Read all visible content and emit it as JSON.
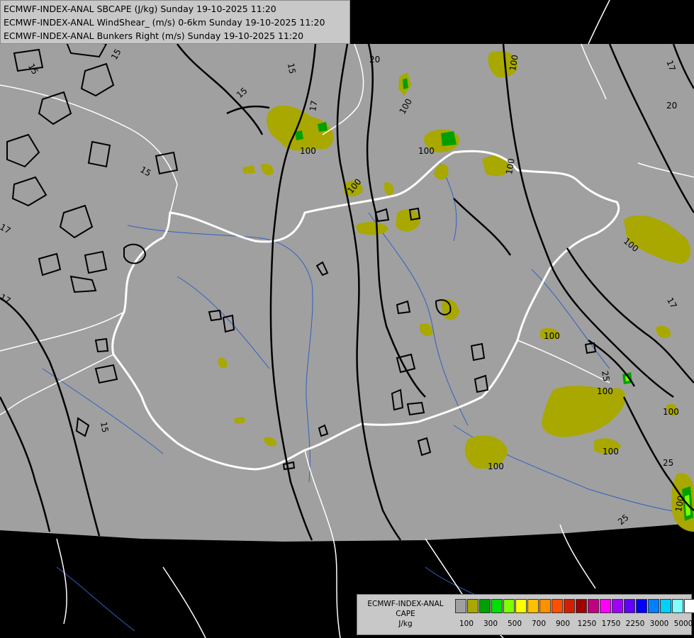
{
  "titles": [
    "ECMWF-INDEX-ANAL SBCAPE (J/kg) Sunday 19-10-2025 11:20",
    "ECMWF-INDEX-ANAL WindShear_ (m/s) 0-6km Sunday 19-10-2025 11:20",
    "ECMWF-INDEX-ANAL Bunkers Right (m/s) Sunday 19-10-2025 11:20"
  ],
  "legend": {
    "line1": "ECMWF-INDEX-ANAL",
    "line2": "CAPE",
    "line3": "J/kg",
    "colors": [
      "#a0a0a0",
      "#a8a800",
      "#00a000",
      "#00e000",
      "#80ff00",
      "#ffff00",
      "#ffc000",
      "#ff9000",
      "#ff5000",
      "#d02000",
      "#a00000",
      "#c00080",
      "#ff00ff",
      "#a000ff",
      "#6000ff",
      "#0000ff",
      "#0080ff",
      "#00d0ff",
      "#80ffff",
      "#ffffff"
    ],
    "tick_labels": [
      "100",
      "300",
      "500",
      "700",
      "900",
      "1250",
      "1750",
      "2250",
      "3000",
      "5000"
    ]
  },
  "contour_labels": {
    "cape": [
      "100",
      "100",
      "100",
      "100",
      "100",
      "100",
      "100",
      "100",
      "100",
      "100",
      "100",
      "100",
      "100"
    ],
    "shear": [
      "15",
      "15",
      "15",
      "15",
      "17",
      "17",
      "17",
      "17",
      "17",
      "20",
      "20",
      "20",
      "25",
      "25",
      "25",
      "15",
      "15"
    ]
  },
  "colors": {
    "domain": "#a0a0a0",
    "outside": "#000000",
    "cape_low": "#a8a800",
    "cape_mid": "#00a000",
    "border": "#ffffff",
    "river": "#3060c0",
    "contour": "#000000"
  }
}
